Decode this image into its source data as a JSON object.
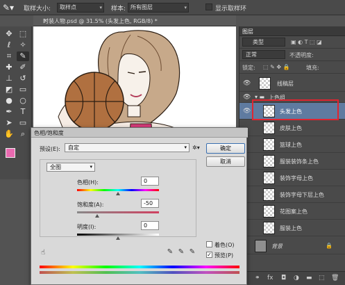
{
  "options_bar": {
    "sample_size_label": "取样大小:",
    "sample_size_value": "取样点",
    "sample_label": "样本:",
    "sample_value": "所有图层",
    "show_ring_label": "显示取样环"
  },
  "document": {
    "tab_title": "时装人物.psd @ 31.5% (头发上色, RGB/8) *",
    "close": "×"
  },
  "toolbox": {
    "tools": [
      "move-icon",
      "marquee-icon",
      "lasso-icon",
      "quick-select-icon",
      "crop-icon",
      "eyedropper-icon",
      "heal-icon",
      "brush-icon",
      "stamp-icon",
      "history-brush-icon",
      "eraser-icon",
      "gradient-icon",
      "blur-icon",
      "dodge-icon",
      "pen-icon",
      "type-icon",
      "path-select-icon",
      "shape-icon",
      "hand-icon",
      "zoom-icon"
    ],
    "foreground_color": "#e96ab0",
    "background_color": "#ffffff"
  },
  "layers_panel": {
    "tab": "图层",
    "filter_kind": "类型",
    "blend_mode": "正常",
    "opacity_label": "不透明度:",
    "lock_label": "锁定:",
    "fill_label": "填充:",
    "layers": [
      {
        "name": "线稿层",
        "visible": true,
        "type": "layer"
      },
      {
        "name": "上色组",
        "visible": true,
        "type": "group"
      },
      {
        "name": "头发上色",
        "visible": true,
        "type": "layer",
        "selected": true
      },
      {
        "name": "皮肤上色",
        "visible": false,
        "type": "layer"
      },
      {
        "name": "篮球上色",
        "visible": false,
        "type": "layer"
      },
      {
        "name": "服装装饰条上色",
        "visible": false,
        "type": "layer"
      },
      {
        "name": "装饰字母上色",
        "visible": false,
        "type": "layer"
      },
      {
        "name": "装饰字母下层上色",
        "visible": false,
        "type": "layer"
      },
      {
        "name": "花图案上色",
        "visible": false,
        "type": "layer"
      },
      {
        "name": "服装上色",
        "visible": false,
        "type": "layer"
      },
      {
        "name": "背景",
        "visible": false,
        "type": "background"
      }
    ],
    "footer_icons": [
      "link-icon",
      "fx-icon",
      "mask-icon",
      "adjustment-icon",
      "folder-icon",
      "new-layer-icon",
      "trash-icon"
    ]
  },
  "dialog": {
    "title": "色相/饱和度",
    "preset_label": "预设(E):",
    "preset_value": "自定",
    "channel_value": "全图",
    "hue_label": "色相(H):",
    "hue_value": "0",
    "saturation_label": "饱和度(A):",
    "saturation_value": "-50",
    "lightness_label": "明度(I):",
    "lightness_value": "0",
    "ok_label": "确定",
    "cancel_label": "取消",
    "colorize_label": "着色(O)",
    "colorize_checked": false,
    "preview_label": "预览(P)",
    "preview_checked": true
  }
}
